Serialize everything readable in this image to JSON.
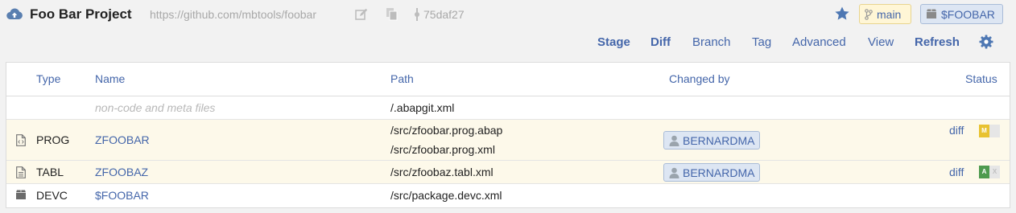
{
  "header": {
    "project_name": "Foo Bar Project",
    "repo_url": "https://github.com/mbtools/foobar",
    "commit_hash": "75daf27",
    "branch": "main",
    "package": "$FOOBAR"
  },
  "toolbar": {
    "stage": "Stage",
    "diff": "Diff",
    "branch": "Branch",
    "tag": "Tag",
    "advanced": "Advanced",
    "view": "View",
    "refresh": "Refresh"
  },
  "table": {
    "columns": {
      "type": "Type",
      "name": "Name",
      "path": "Path",
      "changed_by": "Changed by",
      "status": "Status"
    },
    "rows": [
      {
        "type": "",
        "name": "non-code and meta files",
        "paths": [
          "/.abapgit.xml"
        ],
        "changed_by": "",
        "status": ""
      },
      {
        "type": "PROG",
        "name": "ZFOOBAR",
        "paths": [
          "/src/zfoobar.prog.abap",
          "/src/zfoobar.prog.xml"
        ],
        "changed_by": "BERNARDMA",
        "status": "diff",
        "state_local": "M",
        "state_remote": ""
      },
      {
        "type": "TABL",
        "name": "ZFOOBAZ",
        "paths": [
          "/src/zfoobaz.tabl.xml"
        ],
        "changed_by": "BERNARDMA",
        "status": "diff",
        "state_local": "A",
        "state_remote": "X"
      },
      {
        "type": "DEVC",
        "name": "$FOOBAR",
        "paths": [
          "/src/package.devc.xml"
        ],
        "changed_by": "",
        "status": ""
      }
    ]
  },
  "colors": {
    "link": "#4466aa",
    "highlight_row": "#fdf9ea",
    "state_modified": "#e8c230",
    "state_added": "#4e9a4e"
  }
}
